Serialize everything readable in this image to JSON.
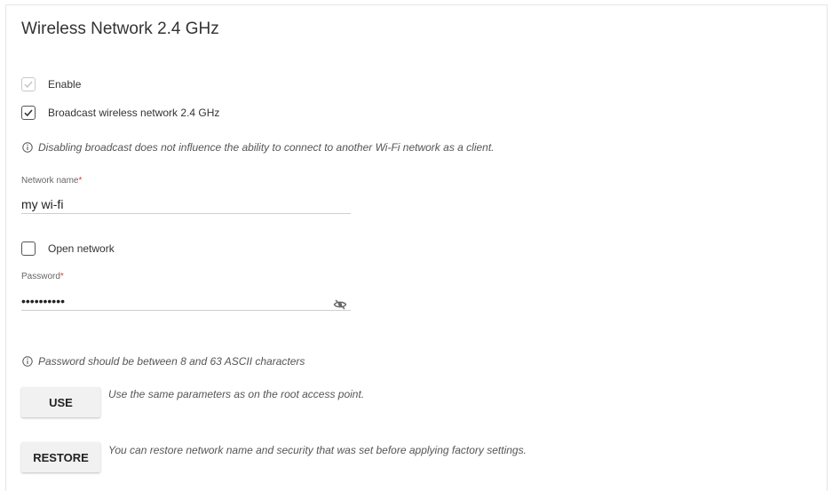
{
  "section": {
    "title": "Wireless Network 2.4 GHz"
  },
  "enable": {
    "label": "Enable",
    "checked": true,
    "disabled": true
  },
  "broadcast": {
    "label": "Broadcast wireless network 2.4 GHz",
    "checked": true
  },
  "broadcast_info": "Disabling broadcast does not influence the ability to connect to another Wi-Fi network as a client.",
  "network_name": {
    "label": "Network name",
    "required_mark": "*",
    "value": "my wi-fi"
  },
  "open_network": {
    "label": "Open network",
    "checked": false
  },
  "password": {
    "label": "Password",
    "required_mark": "*",
    "masked_value": "••••••••••",
    "toggle_icon": "eye-off-icon"
  },
  "password_info": "Password should be between 8 and 63 ASCII characters",
  "use_action": {
    "button_label": "USE",
    "description": "Use the same parameters as on the root access point."
  },
  "restore_action": {
    "button_label": "RESTORE",
    "description": "You can restore network name and security that was set before applying factory settings."
  },
  "colors": {
    "required": "#e53935",
    "button_bg": "#f1f1f1",
    "text": "#333333",
    "muted_text": "#555555"
  }
}
